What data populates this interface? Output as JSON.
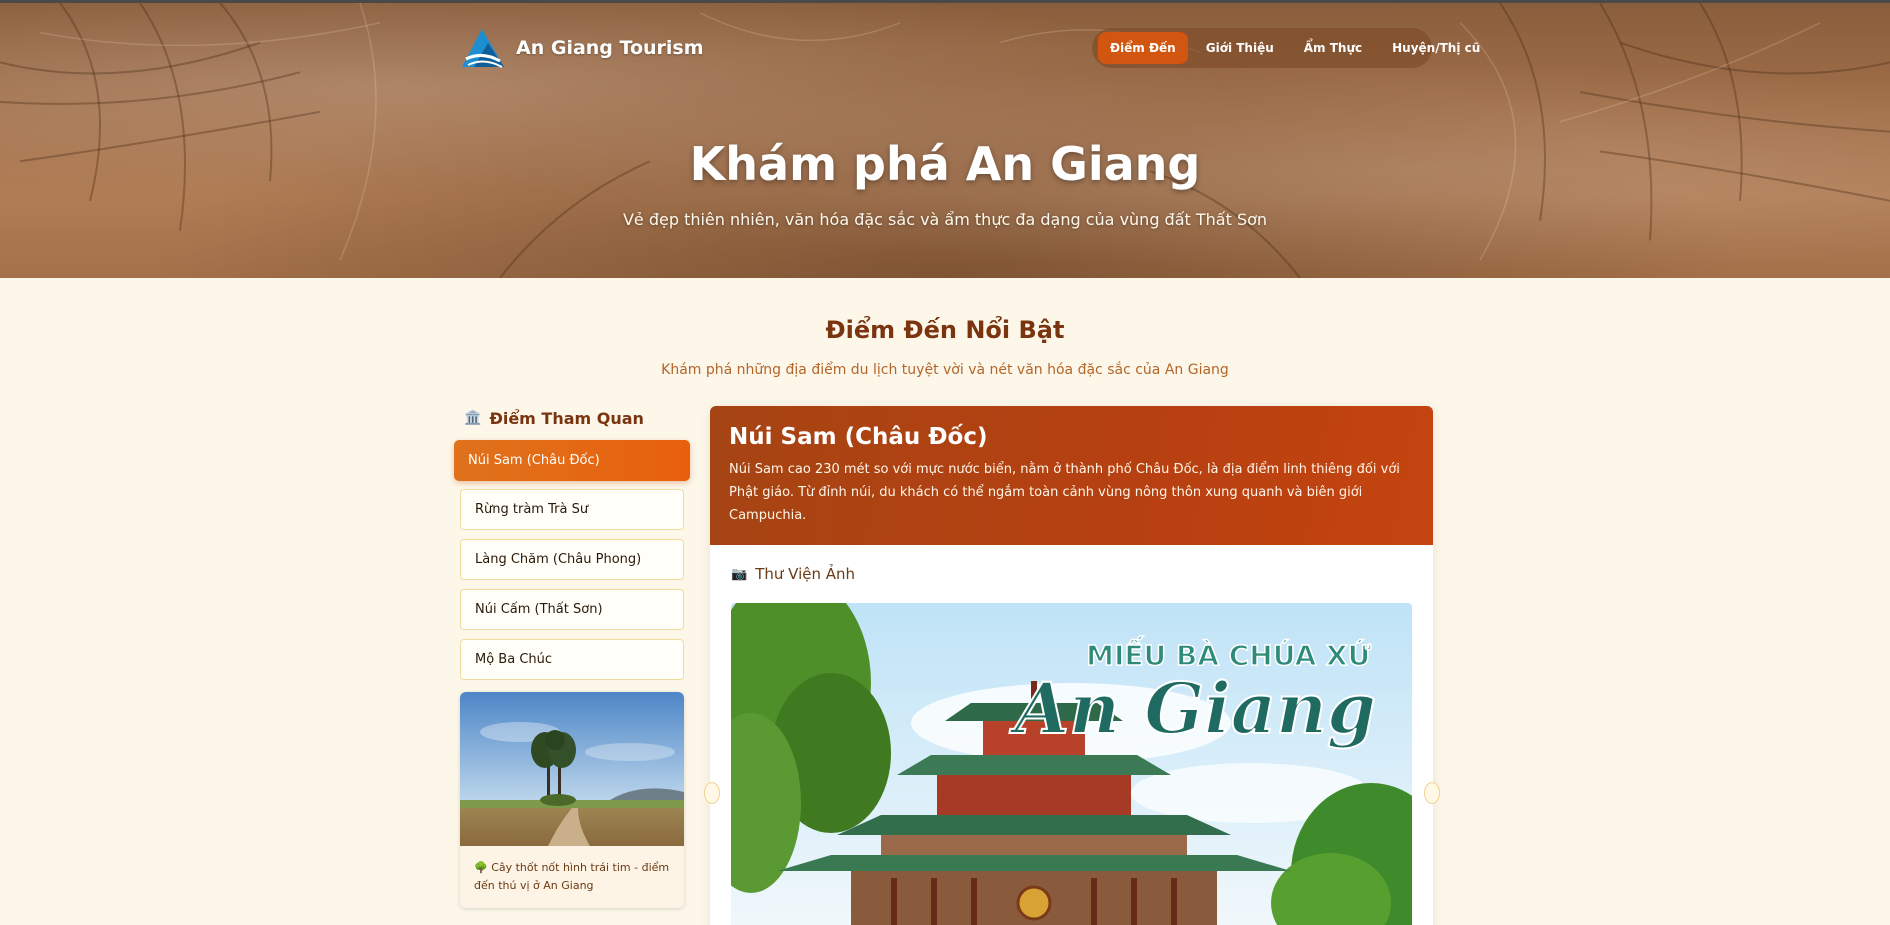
{
  "header": {
    "brand": "An Giang Tourism",
    "nav": [
      {
        "label": "Điểm Đến",
        "active": true
      },
      {
        "label": "Giới Thiệu",
        "active": false
      },
      {
        "label": "Ẩm Thực",
        "active": false
      },
      {
        "label": "Huyện/Thị cũ",
        "active": false
      }
    ]
  },
  "hero": {
    "title": "Khám phá An Giang",
    "subtitle": "Vẻ đẹp thiên nhiên, văn hóa đặc sắc và ẩm thực đa dạng của vùng đất Thất Sơn"
  },
  "section": {
    "title": "Điểm Đến Nổi Bật",
    "subtitle": "Khám phá những địa điểm du lịch tuyệt vời và nét văn hóa đặc sắc của An Giang"
  },
  "sidebar": {
    "heading": "Điểm Tham Quan",
    "heading_icon": "🏛️",
    "items": [
      {
        "label": "Núi Sam (Châu Đốc)",
        "active": true
      },
      {
        "label": "Rừng tràm Trà Sư",
        "active": false
      },
      {
        "label": "Làng Chăm (Châu Phong)",
        "active": false
      },
      {
        "label": "Núi Cấm (Thất Sơn)",
        "active": false
      },
      {
        "label": "Mộ Ba Chúc",
        "active": false
      }
    ],
    "card_caption": "🌳 Cây thốt nốt hình trái tim - điểm đến thú vị ở An Giang"
  },
  "detail": {
    "title": "Núi Sam (Châu Đốc)",
    "description": "Núi Sam cao 230 mét so với mực nước biển, nằm ở thành phố Châu Đốc, là địa điểm linh thiêng đối với Phật giáo. Từ đỉnh núi, du khách có thể ngắm toàn cảnh vùng nông thôn xung quanh và biên giới Campuchia.",
    "gallery_heading": "Thư Viện Ảnh",
    "gallery_icon": "📷",
    "image_text_line1": "MIẾU BÀ CHÚA XỨ",
    "image_text_line2": "An Giang"
  },
  "colors": {
    "accent": "#e0661a",
    "brown": "#7a3510",
    "panel_head": "#b0420f",
    "background": "#fdf7ea"
  }
}
